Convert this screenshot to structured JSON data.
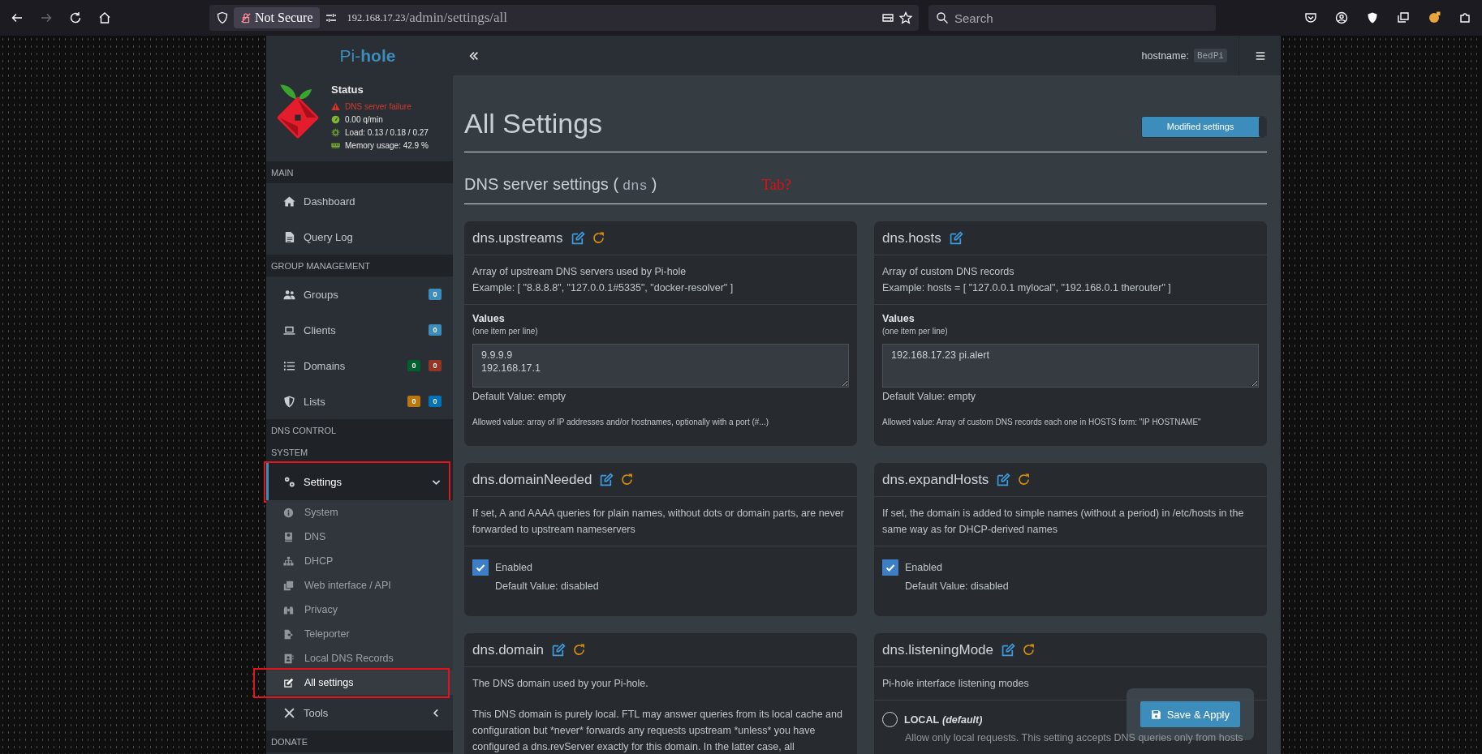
{
  "browser": {
    "security": "Not Secure",
    "url_host": "192.168.17.23",
    "url_path": "/admin/settings/all",
    "search_placeholder": "Search"
  },
  "sidebar": {
    "brand": {
      "prefix": "Pi-",
      "suffix": "hole"
    },
    "status": {
      "title": "Status",
      "items": [
        {
          "kind": "failure",
          "text": "DNS server failure"
        },
        {
          "kind": "rate",
          "text": "0.00 q/min"
        },
        {
          "kind": "load",
          "text": "Load: 0.13 / 0.18 / 0.27"
        },
        {
          "kind": "memory",
          "text": "Memory usage: 42.9 %"
        }
      ]
    },
    "nav": [
      {
        "header": "MAIN",
        "items": [
          {
            "label": "Dashboard",
            "selected": false
          },
          {
            "label": "Query Log",
            "selected": false
          }
        ]
      },
      {
        "header": "GROUP MANAGEMENT",
        "items": [
          {
            "label": "Groups",
            "selected": false,
            "badges": [
              {
                "text": "0",
                "color": "#3c8dbc"
              }
            ]
          },
          {
            "label": "Clients",
            "selected": false,
            "badges": [
              {
                "text": "0",
                "color": "#3c8dbc"
              }
            ]
          },
          {
            "label": "Domains",
            "selected": false,
            "badges": [
              {
                "text": "0",
                "color": "#00612e"
              },
              {
                "text": "0",
                "color": "#953325"
              }
            ]
          },
          {
            "label": "Lists",
            "selected": false,
            "badges": [
              {
                "text": "0",
                "color": "#b9770e"
              },
              {
                "text": "0",
                "color": "#0073b7"
              }
            ]
          }
        ]
      },
      {
        "header": "DNS CONTROL"
      },
      {
        "header": "SYSTEM",
        "items": [
          {
            "label": "Settings",
            "selected": true,
            "expanded": true,
            "annotated": true,
            "children": [
              {
                "label": "System",
                "selected": false,
                "annotated": false
              },
              {
                "label": "DNS",
                "selected": false,
                "annotated": false
              },
              {
                "label": "DHCP",
                "selected": false,
                "annotated": false
              },
              {
                "label": "Web interface / API",
                "selected": false,
                "annotated": false
              },
              {
                "label": "Privacy",
                "selected": false,
                "annotated": false
              },
              {
                "label": "Teleporter",
                "selected": false,
                "annotated": false
              },
              {
                "label": "Local DNS Records",
                "selected": false,
                "annotated": false
              },
              {
                "label": "All settings",
                "selected": true,
                "annotated": true
              }
            ]
          },
          {
            "label": "Tools",
            "selected": false,
            "expanded": false,
            "annotated": false
          }
        ]
      },
      {
        "header": "DONATE"
      }
    ]
  },
  "topbar": {
    "hostname_label": "hostname:",
    "hostname": "BedPi"
  },
  "page": {
    "title": "All Settings",
    "filter_toggle": {
      "label": "Modified settings",
      "on": true
    },
    "section": {
      "before": "DNS server settings (",
      "key": "dns",
      "after": ")"
    },
    "annotation": "Tab?",
    "cards": [
      {
        "name": "dns.upstreams",
        "modified": true,
        "kind": "list",
        "paragraphs": [
          [
            "Array of upstream DNS servers used by Pi-hole",
            "Example: [ \"8.8.8.8\", \"127.0.0.1#5335\", \"docker-resolver\" ]"
          ]
        ],
        "values_label": "Values",
        "values_hint": "(one item per line)",
        "values": [
          "9.9.9.9",
          "192.168.17.1"
        ],
        "default": "Default Value: empty",
        "allowed": "Allowed value: array of IP addresses and/or hostnames, optionally with a port (#...)"
      },
      {
        "name": "dns.hosts",
        "modified": false,
        "kind": "list",
        "paragraphs": [
          [
            "Array of custom DNS records",
            "Example: hosts = [ \"127.0.0.1 mylocal\", \"192.168.0.1 therouter\" ]"
          ]
        ],
        "values_label": "Values",
        "values_hint": "(one item per line)",
        "values": [
          "192.168.17.23 pi.alert"
        ],
        "default": "Default Value: empty",
        "allowed": "Allowed value: Array of custom DNS records each one in HOSTS form: \"IP HOSTNAME\""
      },
      {
        "name": "dns.domainNeeded",
        "modified": true,
        "kind": "checkbox",
        "paragraphs": [
          [
            "If set, A and AAAA queries for plain names, without dots or domain parts, are never forwarded to upstream nameservers"
          ]
        ],
        "checked": true,
        "label": "Enabled",
        "default": "Default Value: disabled"
      },
      {
        "name": "dns.expandHosts",
        "modified": true,
        "kind": "checkbox",
        "paragraphs": [
          [
            "If set, the domain is added to simple names (without a period) in /etc/hosts in the same way as for DHCP-derived names"
          ]
        ],
        "checked": true,
        "label": "Enabled",
        "default": "Default Value: disabled"
      },
      {
        "name": "dns.domain",
        "modified": true,
        "kind": "text",
        "paragraphs": [
          [
            "The DNS domain used by your Pi-hole."
          ],
          [
            "This DNS domain is purely local. FTL may answer queries from its local cache and configuration but *never* forwards any requests upstream *unless* you have configured a dns.revServer exactly for this domain. In the latter case, all"
          ]
        ]
      },
      {
        "name": "dns.listeningMode",
        "modified": true,
        "kind": "radio",
        "paragraphs": [
          [
            "Pi-hole interface listening modes"
          ]
        ],
        "options": [
          {
            "label": "LOCAL",
            "note": "(default)",
            "selected": false,
            "description": "Allow only local requests. This setting accepts DNS queries only from hosts"
          }
        ]
      }
    ],
    "save_button": "Save & Apply"
  }
}
